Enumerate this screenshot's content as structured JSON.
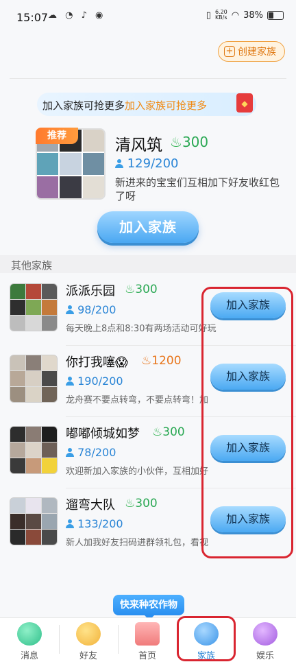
{
  "status_bar": {
    "time": "15:07",
    "net_speed": "6.20\nKB/s",
    "battery": "38%"
  },
  "header": {
    "create_label": "创建家族"
  },
  "banner": {
    "text_plain": "加入家族可抢更多",
    "text_highlight": "加入家族可抢更多"
  },
  "recommended": {
    "tag": "推荐",
    "name": "清风筑",
    "score": "300",
    "members": "129/200",
    "description": "新进来的宝宝们互相加下好友收红包了呀",
    "join_label": "加入家族"
  },
  "section_title": "其他家族",
  "families": [
    {
      "name": "派派乐园",
      "score": "300",
      "score_color": "#2aa853",
      "members": "98/200",
      "description": "每天晚上8点和8:30有两场活动可好玩",
      "join_label": "加入家族"
    },
    {
      "name": "你打我噻😱",
      "score": "1200",
      "score_color": "#e8751a",
      "members": "190/200",
      "description": "龙舟赛不要点转弯，不要点转弯！加",
      "join_label": "加入家族"
    },
    {
      "name": "嘟嘟倾城如梦",
      "score": "300",
      "score_color": "#2aa853",
      "members": "78/200",
      "description": "欢迎新加入家族的小伙伴，互相加好",
      "join_label": "加入家族"
    },
    {
      "name": "遛弯大队",
      "score": "300",
      "score_color": "#2aa853",
      "members": "133/200",
      "description": "新人加我好友扫码进群领礼包，看视",
      "join_label": "加入家族"
    }
  ],
  "tooltip": "快来种农作物",
  "tabs": [
    {
      "label": "消息",
      "icon": "message-icon"
    },
    {
      "label": "好友",
      "icon": "friends-icon"
    },
    {
      "label": "首页",
      "icon": "home-icon"
    },
    {
      "label": "家族",
      "icon": "family-icon"
    },
    {
      "label": "娱乐",
      "icon": "planet-icon"
    }
  ],
  "colors": {
    "accent": "#2a85d6",
    "join_button": "#4ba9f2",
    "highlight": "#d92530",
    "orange": "#f08a14"
  }
}
